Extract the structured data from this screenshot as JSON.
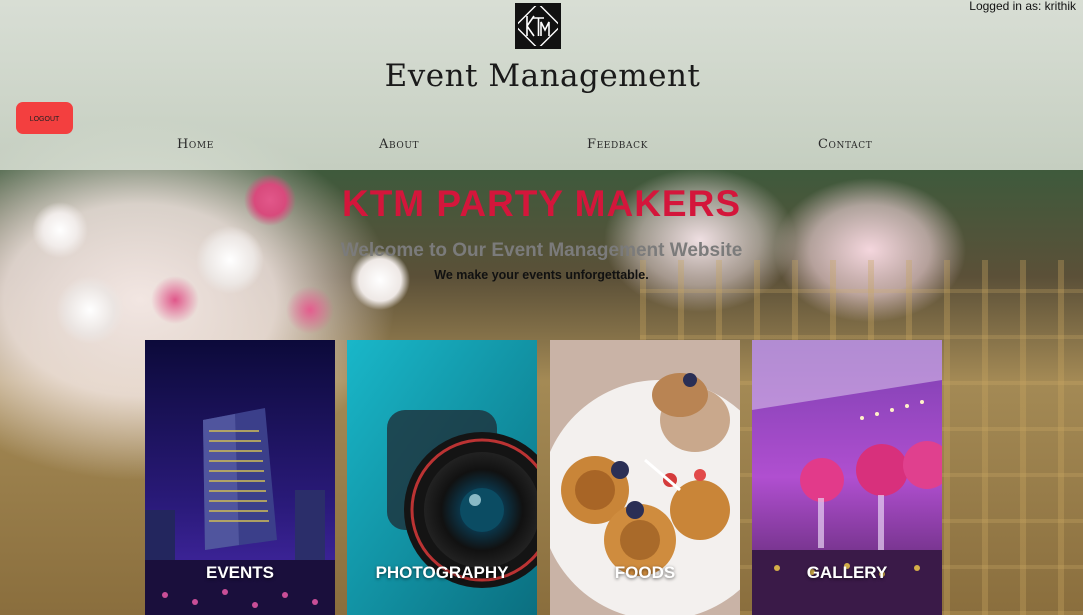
{
  "header": {
    "logo_icon": "ktm-logo-icon",
    "brand_name": "Event Management",
    "logged_in_text": "Logged in as: krithik",
    "logout_label": "Logout"
  },
  "nav": {
    "items": [
      {
        "label": "Home"
      },
      {
        "label": "About"
      },
      {
        "label": "Feedback"
      },
      {
        "label": "Contact"
      }
    ]
  },
  "hero": {
    "title": "KTM PARTY MAKERS",
    "subtitle": "Welcome to Our Event Management Website",
    "tagline": "We make your events unforgettable."
  },
  "cards": [
    {
      "label": "EVENTS",
      "image": "city-night-concert-image"
    },
    {
      "label": "PHOTOGRAPHY",
      "image": "camera-lens-image"
    },
    {
      "label": "FOODS",
      "image": "waffle-dessert-image"
    },
    {
      "label": "GALLERY",
      "image": "banquet-hall-image"
    }
  ],
  "colors": {
    "title_red": "#d4163b",
    "logout_red": "#f33f3f",
    "subtitle_gray": "#7b7b7b"
  }
}
